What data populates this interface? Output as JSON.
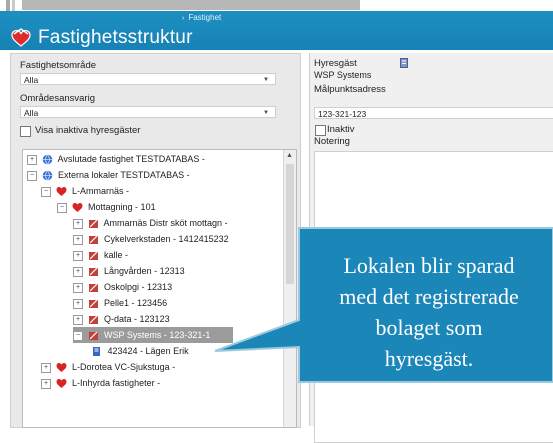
{
  "header": {
    "breadcrumb": "Fastighet",
    "title": "Fastighetsstruktur"
  },
  "filters": {
    "area_label": "Fastighetsområde",
    "area_value": "Alla",
    "responsible_label": "Områdesansvarig",
    "responsible_value": "Alla",
    "inactive_label": "Visa inaktiva hyresgäster"
  },
  "tree": {
    "items": [
      {
        "label": "Avslutade fastighet TESTDATABAS -",
        "icon": "globe-icon"
      },
      {
        "label": "Externa lokaler TESTDATABAS -",
        "icon": "globe-icon"
      },
      {
        "label": "L-Ammarnäs -",
        "icon": "heart-icon"
      },
      {
        "label": "Mottagning - 101",
        "icon": "heart-icon"
      },
      {
        "label": "Ammarnäs Distr sköt mottagn -",
        "icon": "room-icon"
      },
      {
        "label": "Cykelverkstaden - 1412415232",
        "icon": "room-icon"
      },
      {
        "label": "kalle -",
        "icon": "room-icon"
      },
      {
        "label": "Långvården - 12313",
        "icon": "room-icon"
      },
      {
        "label": "Oskolpgi - 12313",
        "icon": "room-icon"
      },
      {
        "label": "Pelle1 - 123456",
        "icon": "room-icon"
      },
      {
        "label": "Q-data - 123123",
        "icon": "room-icon"
      },
      {
        "label": "WSP Systems - 123-321-1",
        "icon": "room-icon"
      },
      {
        "label": "423424 - Lägen Erik",
        "icon": "tenant-icon"
      },
      {
        "label": "L-Dorotea VC-Sjukstuga -",
        "icon": "heart-icon"
      },
      {
        "label": "L-Inhyrda fastigheter -",
        "icon": "heart-icon"
      }
    ]
  },
  "details": {
    "tenant_label": "Hyresgäst",
    "tenant_value": "WSP Systems",
    "address_label": "Målpunktsadress",
    "address_value": "123-321-123",
    "inactive_label": "Inaktiv",
    "note_label": "Notering"
  },
  "callout": {
    "line1": "Lokalen blir sparad",
    "line2": "med det registrerade",
    "line3": "bolaget som",
    "line4": "hyresgäst."
  },
  "colors": {
    "header": "#1b8cc0",
    "callout": "#1b86b8",
    "callout_border": "#9bc9de",
    "selection": "#9b9b9b"
  }
}
